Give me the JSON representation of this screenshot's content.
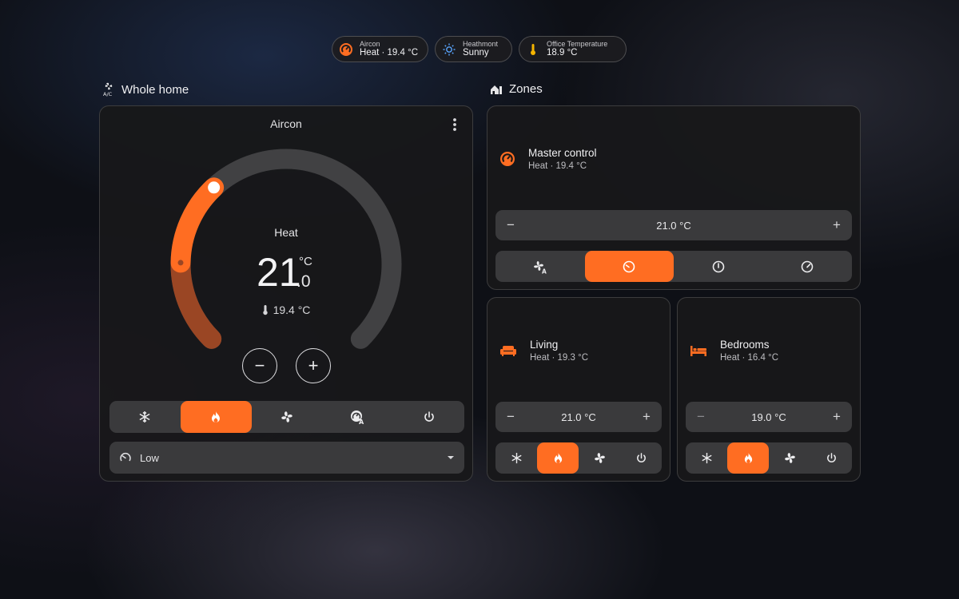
{
  "colors": {
    "accent": "#ff6d22",
    "accent_dark": "#9a4624",
    "track": "#414143",
    "segment_bg": "#3a3a3c",
    "card_bg": "#181818"
  },
  "chips": [
    {
      "icon": "aircon-gauge-icon",
      "label": "Aircon",
      "value": "Heat · 19.4 °C"
    },
    {
      "icon": "sun-icon",
      "label": "Heathmont",
      "value": "Sunny"
    },
    {
      "icon": "thermometer-icon",
      "label": "Office Temperature",
      "value": "18.9 °C"
    }
  ],
  "whole_home": {
    "heading": "Whole home",
    "heading_icon": "ac-unit-icon",
    "card_title": "Aircon",
    "mode": "Heat",
    "target_int": "21",
    "target_dec": ".0",
    "unit": "°C",
    "current": "19.4 °C",
    "dial_target_fraction": 0.34,
    "dial_current_fraction": 0.17,
    "modes": [
      "snowflake-icon",
      "flame-icon",
      "fan-icon",
      "auto-gauge-icon",
      "power-icon"
    ],
    "active_mode": 1,
    "fan_speed_label": "Low"
  },
  "zones": {
    "heading": "Zones",
    "master": {
      "name": "Master control",
      "status": "Heat · 19.4 °C",
      "target": "21.0 °C",
      "fan_modes": [
        "fan-auto-icon",
        "gauge-low-icon",
        "gauge-medium-icon",
        "gauge-high-icon"
      ],
      "active_fan_mode": 1
    },
    "living": {
      "name": "Living",
      "status": "Heat · 19.3 °C",
      "target": "21.0 °C",
      "active_mode": 1
    },
    "bedrooms": {
      "name": "Bedrooms",
      "status": "Heat · 16.4 °C",
      "target": "19.0 °C",
      "active_mode": 1
    }
  },
  "symbols": {
    "minus": "−",
    "plus": "+"
  }
}
